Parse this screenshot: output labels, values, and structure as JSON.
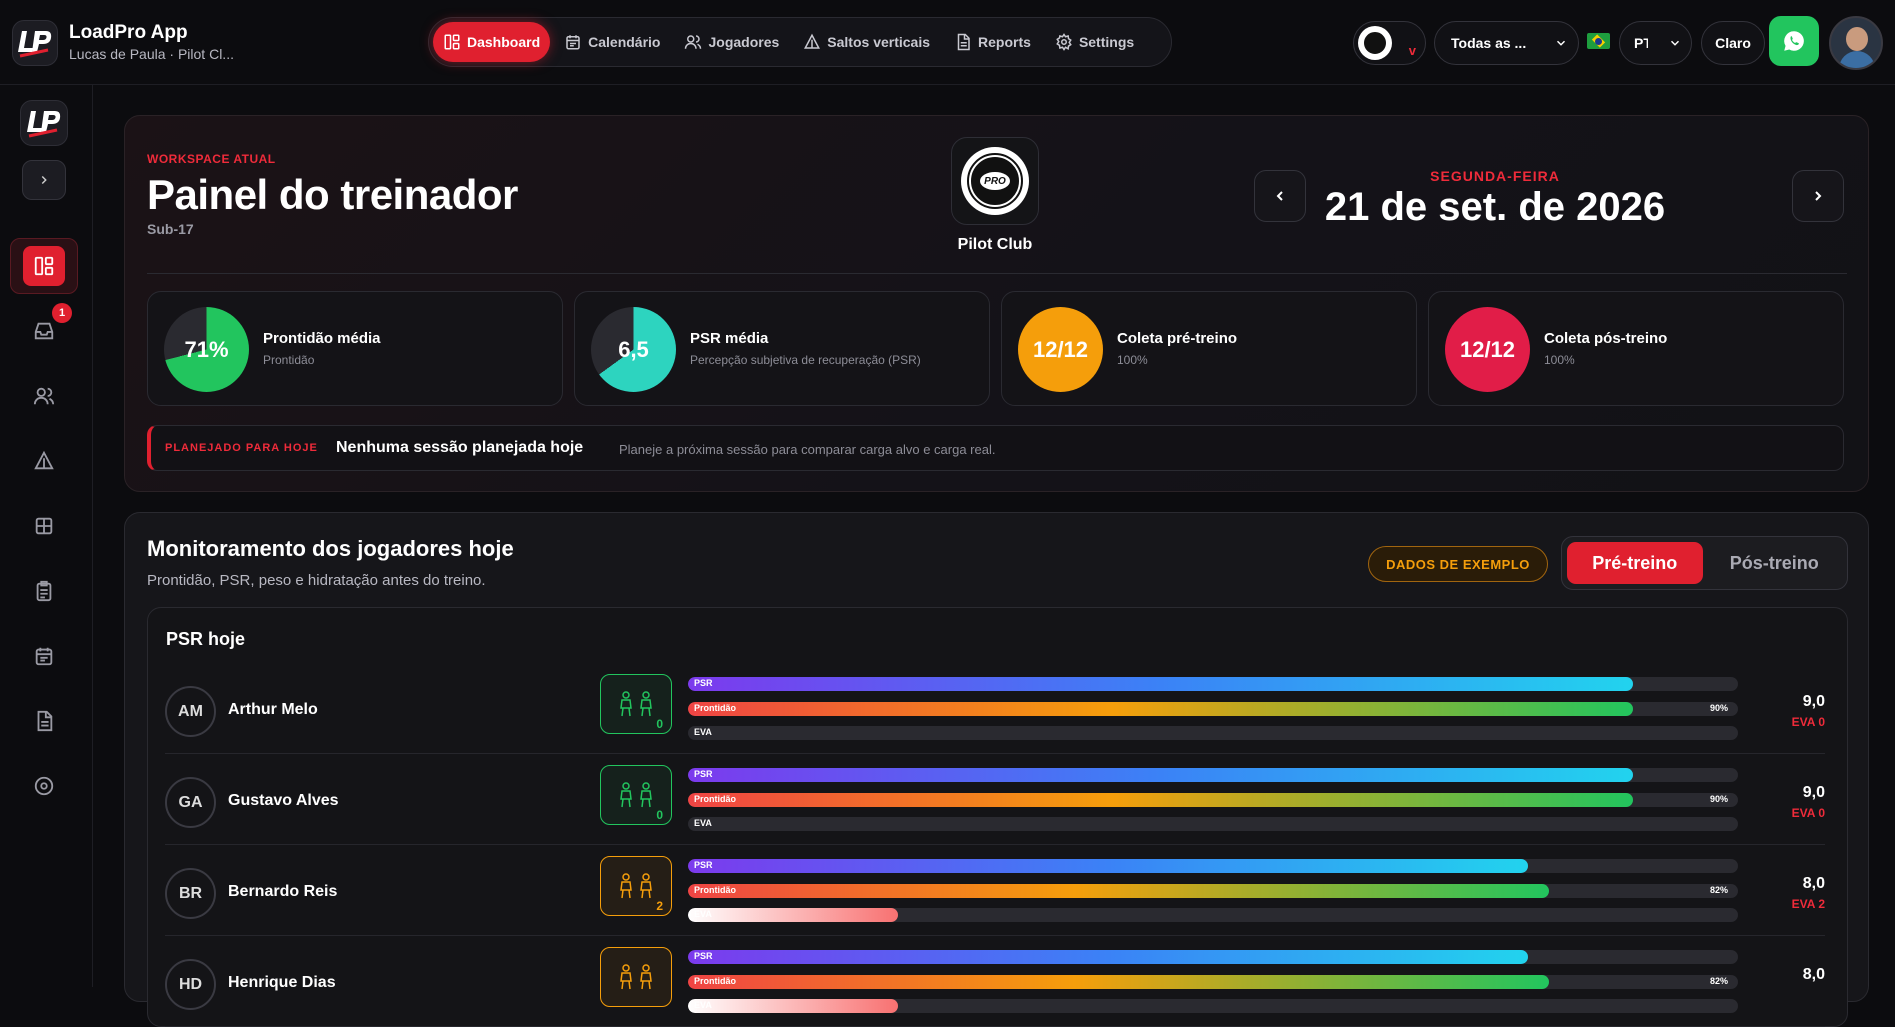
{
  "app": {
    "name": "LoadPro App",
    "user": "Lucas de Paula · Pilot Cl..."
  },
  "nav": [
    {
      "label": "Dashboard",
      "icon": "dashboard-icon",
      "active": true
    },
    {
      "label": "Calendário",
      "icon": "calendar-icon"
    },
    {
      "label": "Jogadores",
      "icon": "players-icon"
    },
    {
      "label": "Saltos verticais",
      "icon": "jump-icon"
    },
    {
      "label": "Reports",
      "icon": "document-icon"
    },
    {
      "label": "Settings",
      "icon": "gear-icon"
    }
  ],
  "controls": {
    "club_badge": "v",
    "team_select": "Todas as ...",
    "lang_select": "PT",
    "theme": "Claro"
  },
  "sidebar": {
    "inbox_badge": "1"
  },
  "header": {
    "eyebrow": "WORKSPACE ATUAL",
    "title": "Painel do treinador",
    "subtitle": "Sub-17",
    "club_name": "Pilot Club",
    "club_logo_text": "THE HOUSE OF PRO HARD WORK",
    "weekday": "SEGUNDA-FEIRA",
    "date": "21 de set. de 2026"
  },
  "kpis": [
    {
      "value": "71%",
      "percent": 71,
      "title": "Prontidão média",
      "sub": "Prontidão",
      "color": "#22c55e"
    },
    {
      "value": "6,5",
      "percent": 65,
      "title": "PSR média",
      "sub": "Percepção subjetiva de recuperação (PSR)",
      "color": "#2dd4bf"
    },
    {
      "value": "12/12",
      "percent": 100,
      "title": "Coleta pré-treino",
      "sub": "100%",
      "color": "#f59e0b"
    },
    {
      "value": "12/12",
      "percent": 100,
      "title": "Coleta pós-treino",
      "sub": "100%",
      "color": "#e11d48"
    }
  ],
  "planned": {
    "label": "PLANEJADO PARA HOJE",
    "title": "Nenhuma sessão planejada hoje",
    "hint": "Planeje a próxima sessão para comparar carga alvo e carga real."
  },
  "monitor": {
    "title": "Monitoramento dos jogadores hoje",
    "subtitle": "Prontidão, PSR, peso e hidratação antes do treino.",
    "sample_badge": "DADOS DE EXEMPLO",
    "tab_pre": "Pré-treino",
    "tab_post": "Pós-treino",
    "section": "PSR hoje"
  },
  "bar_labels": {
    "psr": "PSR",
    "prontidao": "Prontidão",
    "eva": "EVA"
  },
  "players": [
    {
      "initials": "AM",
      "name": "Arthur Melo",
      "pain": "0",
      "status_color": "#22c55e",
      "psr": 90,
      "prontidao": 90,
      "prontidao_label": "90%",
      "eva": 0,
      "score": "9,0",
      "eva_label": "EVA 0"
    },
    {
      "initials": "GA",
      "name": "Gustavo Alves",
      "pain": "0",
      "status_color": "#22c55e",
      "psr": 90,
      "prontidao": 90,
      "prontidao_label": "90%",
      "eva": 0,
      "score": "9,0",
      "eva_label": "EVA 0"
    },
    {
      "initials": "BR",
      "name": "Bernardo Reis",
      "pain": "2",
      "status_color": "#f59e0b",
      "psr": 80,
      "prontidao": 82,
      "prontidao_label": "82%",
      "eva": 20,
      "score": "8,0",
      "eva_label": "EVA 2"
    },
    {
      "initials": "HD",
      "name": "Henrique Dias",
      "pain": "",
      "status_color": "#f59e0b",
      "psr": 80,
      "prontidao": 82,
      "prontidao_label": "82%",
      "eva": 20,
      "score": "8,0",
      "eva_label": ""
    }
  ]
}
